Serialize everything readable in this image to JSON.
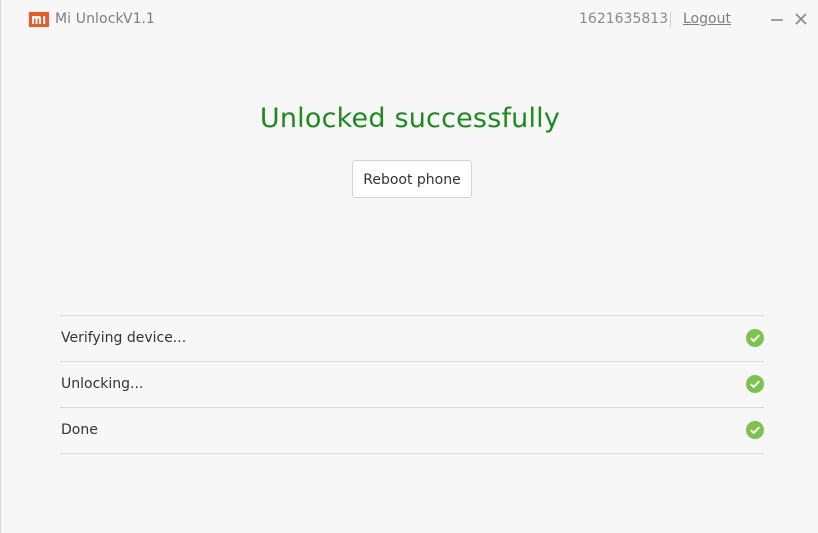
{
  "titlebar": {
    "app_name": "Mi Unlock",
    "version": "V1.1",
    "account_id": "1621635813",
    "logout_label": "Logout",
    "logo_icon": "mi-logo-icon",
    "logo_color": "#f05a22"
  },
  "main": {
    "headline": "Unlocked successfully",
    "headline_color": "#1d8a1d",
    "reboot_label": "Reboot phone"
  },
  "steps": [
    {
      "label": "Verifying device...",
      "status": "complete",
      "icon": "check-circle-icon"
    },
    {
      "label": "Unlocking...",
      "status": "complete",
      "icon": "check-circle-icon"
    },
    {
      "label": "Done",
      "status": "complete",
      "icon": "check-circle-icon"
    }
  ],
  "colors": {
    "check": "#7cc34c",
    "background": "#f7f7f7"
  }
}
